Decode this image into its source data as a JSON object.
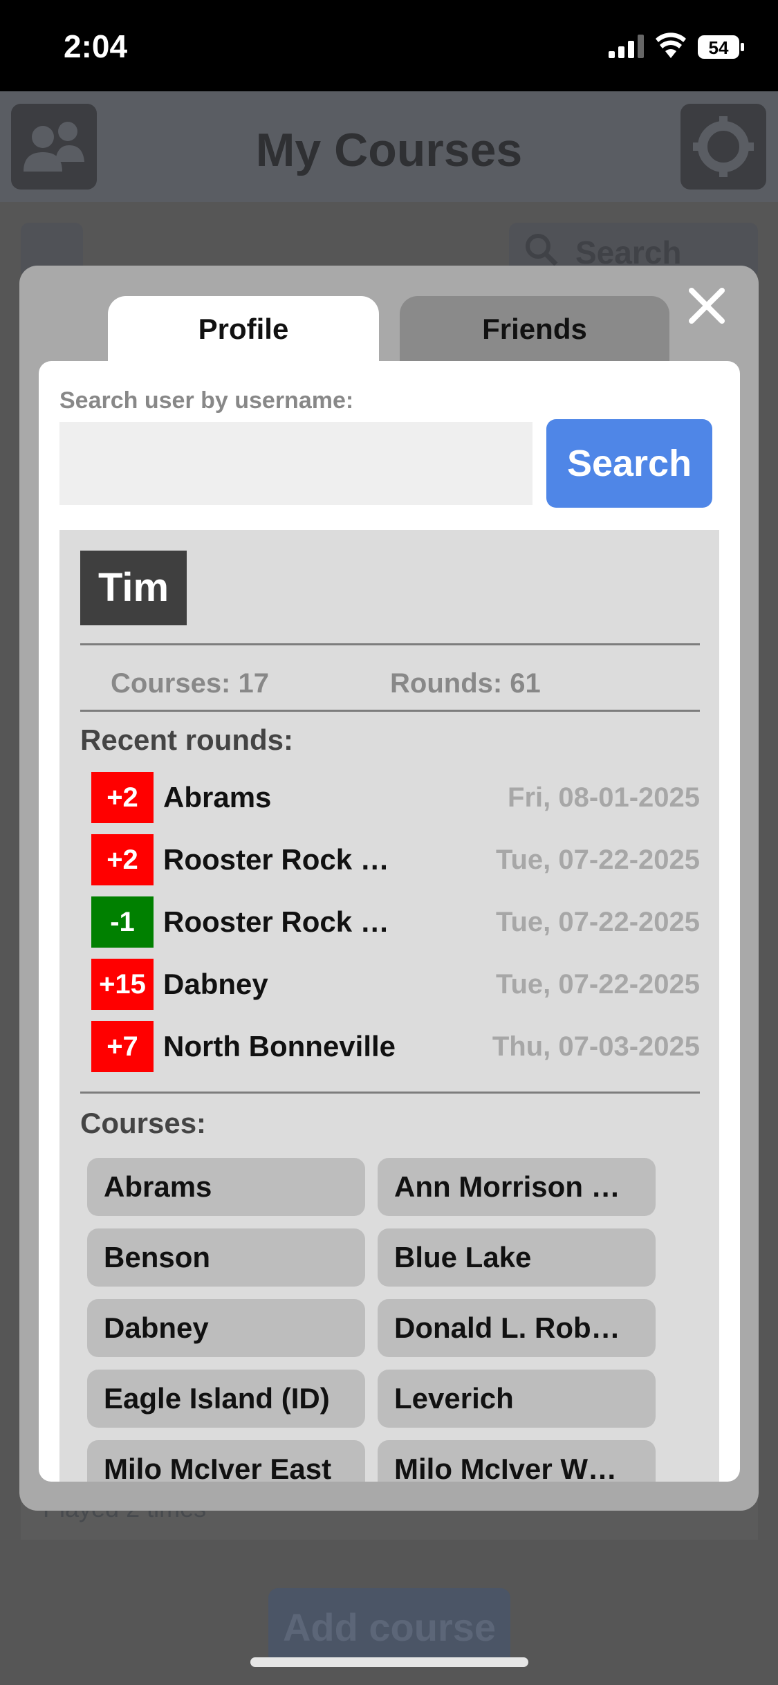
{
  "status_bar": {
    "time": "2:04",
    "battery": "54"
  },
  "background": {
    "title": "My Courses",
    "search_label": "Search",
    "played_text": "Played 2 times",
    "add_course_label": "Add course"
  },
  "modal": {
    "tabs": [
      {
        "label": "Profile",
        "active": true
      },
      {
        "label": "Friends",
        "active": false
      }
    ],
    "search": {
      "label": "Search user by username:",
      "value": "",
      "placeholder": "",
      "button_label": "Search"
    },
    "profile": {
      "username": "Tim",
      "courses_stat": "Courses: 17",
      "rounds_stat": "Rounds: 61",
      "recent_title": "Recent rounds:",
      "recent_rounds": [
        {
          "score": "+2",
          "course": "Abrams",
          "date": "Fri, 08-01-2025",
          "color": "#ff0000"
        },
        {
          "score": "+2",
          "course": "Rooster Rock …",
          "date": "Tue, 07-22-2025",
          "color": "#ff0000"
        },
        {
          "score": "-1",
          "course": "Rooster Rock …",
          "date": "Tue, 07-22-2025",
          "color": "#008000"
        },
        {
          "score": "+15",
          "course": "Dabney",
          "date": "Tue, 07-22-2025",
          "color": "#ff0000"
        },
        {
          "score": "+7",
          "course": "North Bonneville",
          "date": "Thu, 07-03-2025",
          "color": "#ff0000"
        }
      ],
      "courses_title": "Courses:",
      "courses": [
        "Abrams",
        "Ann Morrison …",
        "Benson",
        "Blue Lake",
        "Dabney",
        "Donald L. Rob…",
        "Eagle Island (ID)",
        "Leverich",
        "Milo McIver East",
        "Milo McIver W…"
      ]
    }
  },
  "colors": {
    "accent": "#4f86e7",
    "over_par": "#ff0000",
    "under_par": "#008000"
  }
}
